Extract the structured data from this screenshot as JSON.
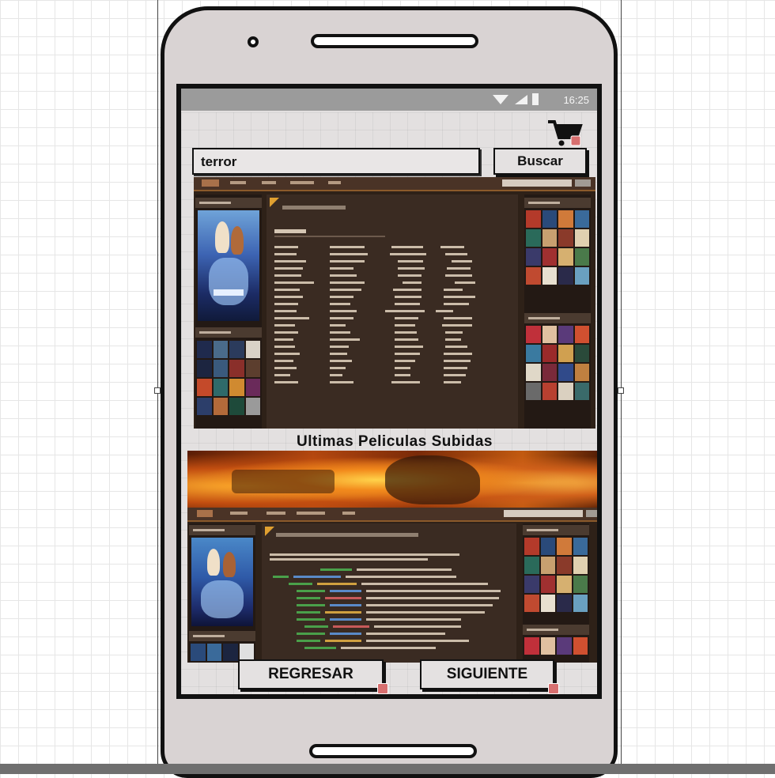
{
  "phone": {
    "status_time": "16:25"
  },
  "search": {
    "value": "terror",
    "button_label": "Buscar"
  },
  "banner": {
    "text": "Ultimas Peliculas Subidas"
  },
  "nav": {
    "back_label": "REGRESAR",
    "next_label": "SIGUIENTE"
  },
  "colors": {
    "site_background": "#2e2118",
    "site_accent": "#e0a030",
    "badge": "#d76f6f",
    "screen_background": "#e3e0e0"
  },
  "icons": [
    "cart-icon",
    "wifi-icon",
    "signal-icon",
    "battery-icon",
    "link-badge-icon"
  ]
}
